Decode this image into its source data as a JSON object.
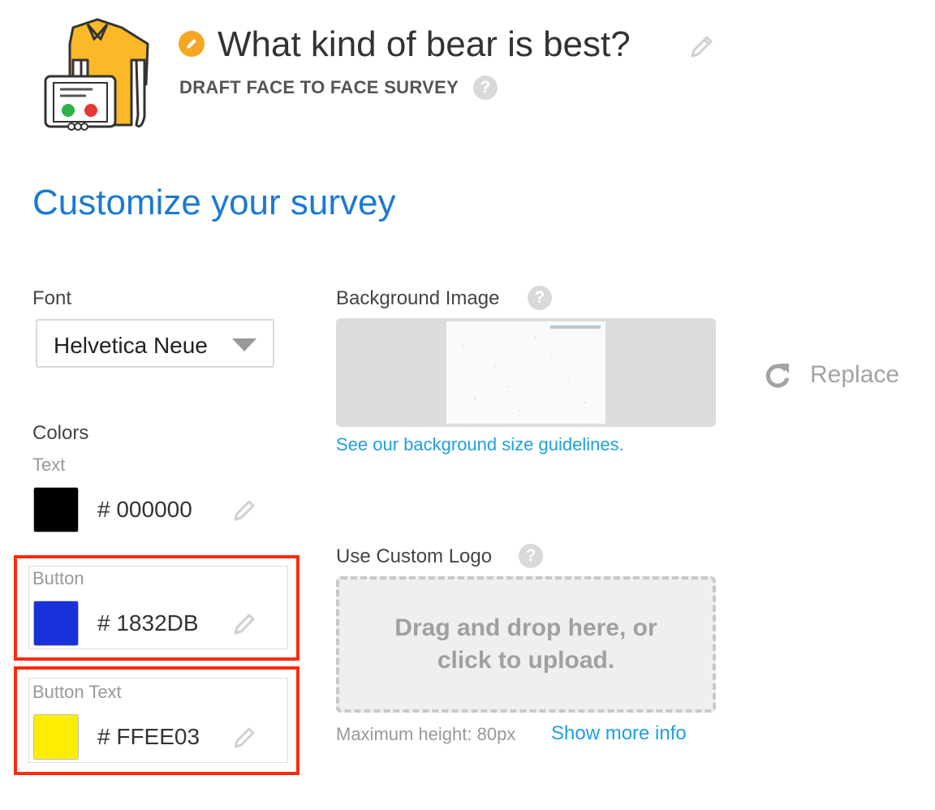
{
  "header": {
    "title": "What kind of bear is best?",
    "subtitle": "DRAFT FACE TO FACE SURVEY",
    "help_glyph": "?"
  },
  "section_title": "Customize your survey",
  "font": {
    "label": "Font",
    "selected": "Helvetica Neue"
  },
  "colors": {
    "label": "Colors",
    "items": [
      {
        "label": "Text",
        "hex": "# 000000",
        "swatch": "#000000"
      },
      {
        "label": "Button",
        "hex": "# 1832DB",
        "swatch": "#1832DB"
      },
      {
        "label": "Button Text",
        "hex": "# FFEE03",
        "swatch": "#FFEE03"
      }
    ]
  },
  "background_image": {
    "label": "Background Image",
    "guidelines_link": "See our background size guidelines.",
    "replace_label": "Replace"
  },
  "custom_logo": {
    "label": "Use Custom Logo",
    "dropzone_line1": "Drag and drop here, or",
    "dropzone_line2": "click to upload.",
    "max_height": "Maximum height: 80px",
    "more_info_link": "Show more info"
  },
  "theme": {
    "accent_blue": "#1a7ad4",
    "link_blue": "#1fa0e0",
    "badge_orange": "#f5a623",
    "highlight_red": "#ff2a0f"
  },
  "icons": [
    "survey-illustration-icon",
    "pencil-icon",
    "help-icon",
    "dropdown-arrow-icon",
    "replace-icon"
  ]
}
